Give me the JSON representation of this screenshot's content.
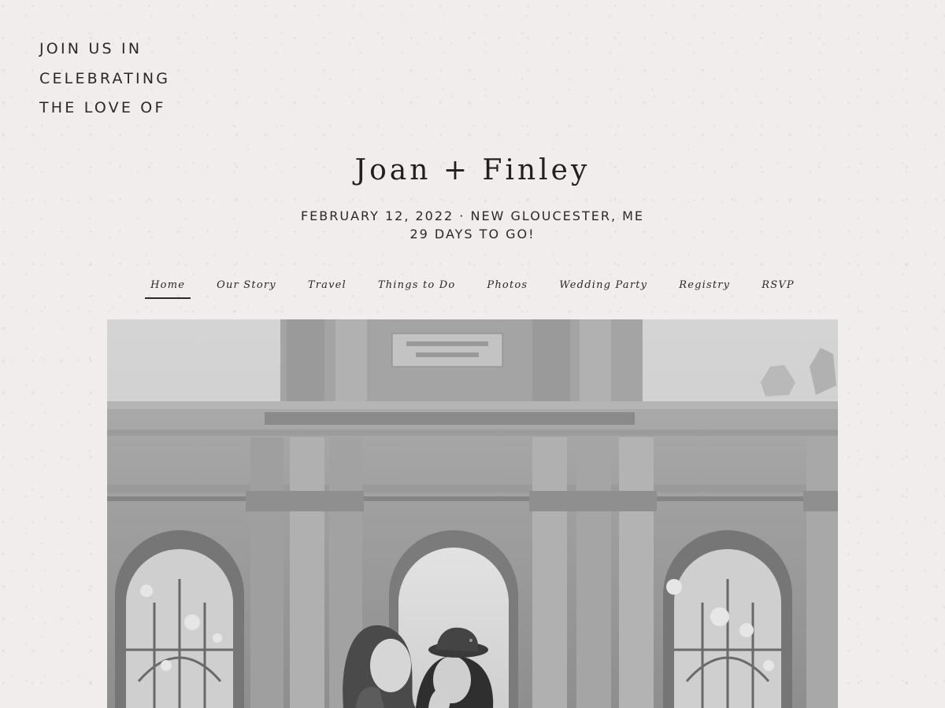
{
  "intro": {
    "line1": "JOIN US IN",
    "line2": "CELEBRATING",
    "line3": "THE LOVE OF"
  },
  "couple": {
    "names": "Joan + Finley"
  },
  "event": {
    "date_location": "FEBRUARY 12, 2022 · NEW GLOUCESTER, ME",
    "countdown": "29 DAYS TO GO!"
  },
  "nav": {
    "items": [
      {
        "label": "Home",
        "active": true
      },
      {
        "label": "Our Story"
      },
      {
        "label": "Travel"
      },
      {
        "label": "Things to Do"
      },
      {
        "label": "Photos"
      },
      {
        "label": "Wedding Party"
      },
      {
        "label": "Registry"
      },
      {
        "label": "RSVP"
      }
    ]
  },
  "hero": {
    "photo_style": "black-and-white"
  },
  "colors": {
    "background": "#f1eded",
    "text": "#2d2828",
    "heading": "#231f1f"
  }
}
